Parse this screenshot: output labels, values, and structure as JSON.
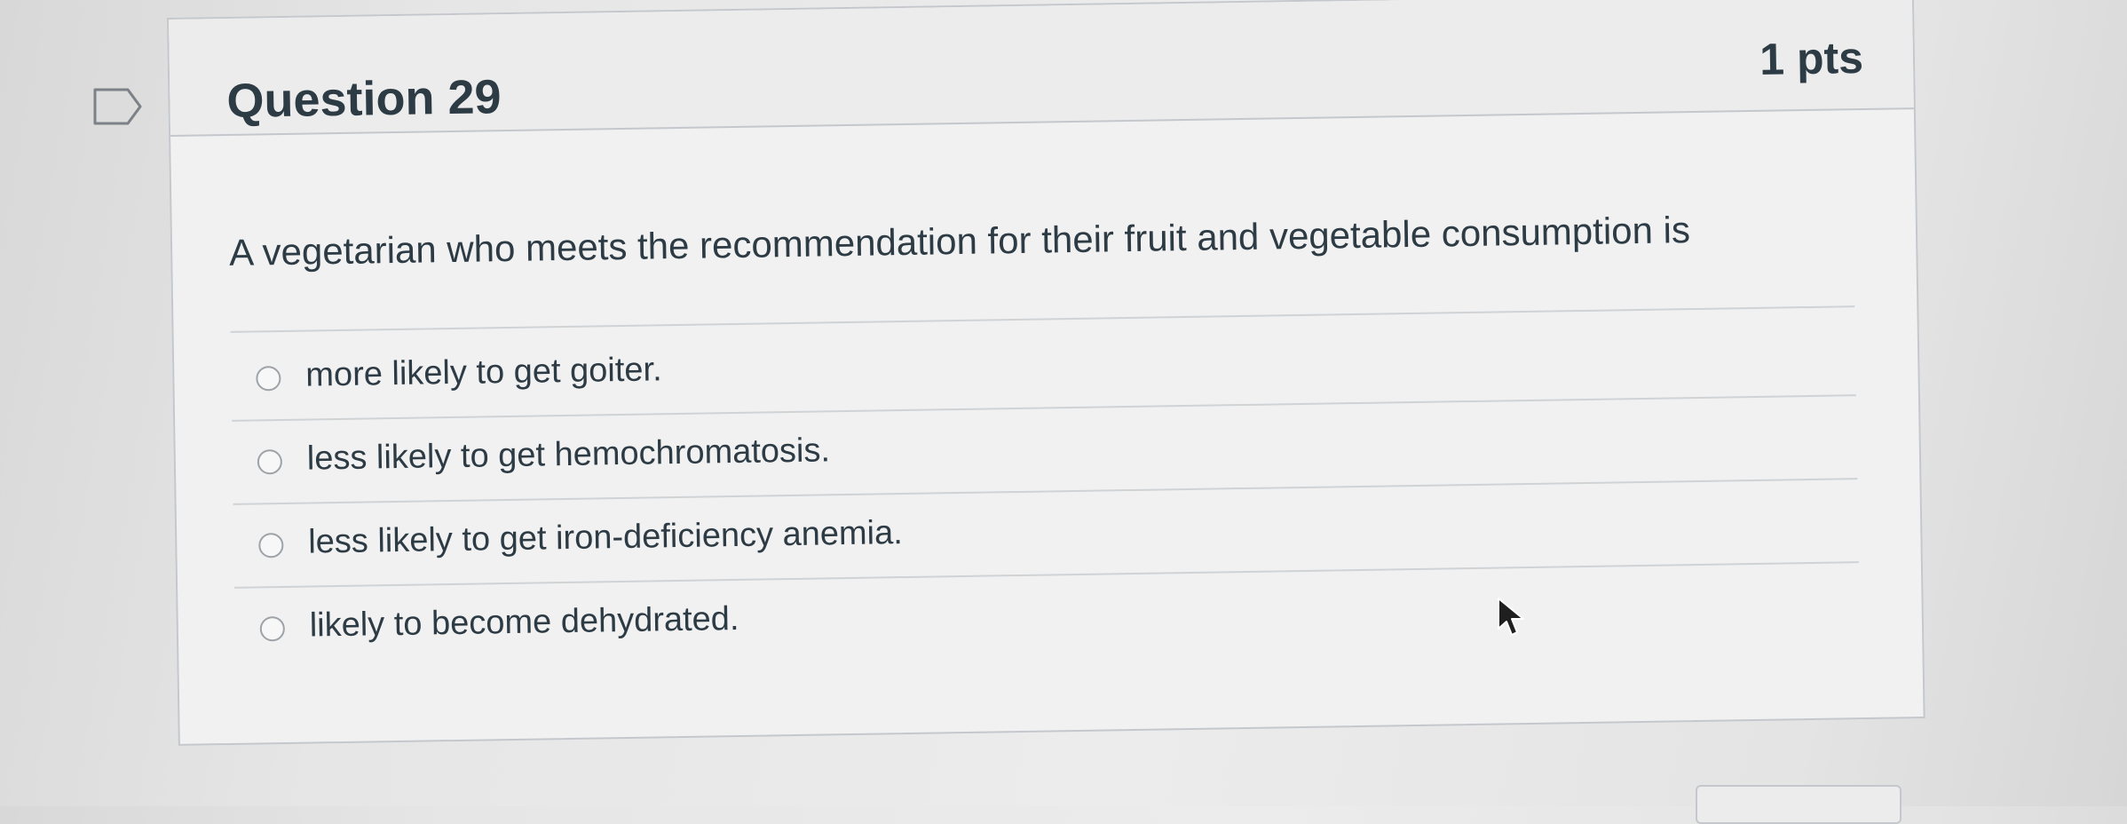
{
  "question": {
    "title": "Question 29",
    "points": "1 pts",
    "text": "A vegetarian who meets the recommendation for their fruit and vegetable consumption is",
    "answers": [
      {
        "label": "more likely to get goiter."
      },
      {
        "label": "less likely to get hemochromatosis."
      },
      {
        "label": "less likely to get iron-deficiency anemia."
      },
      {
        "label": "likely to become dehydrated."
      }
    ]
  },
  "icons": {
    "flag": "flag-icon",
    "cursor": "mouse-cursor-icon",
    "radio": "radio-button"
  },
  "colors": {
    "text": "#2d3b45",
    "border": "#c4c8cc",
    "background": "#ececec"
  }
}
